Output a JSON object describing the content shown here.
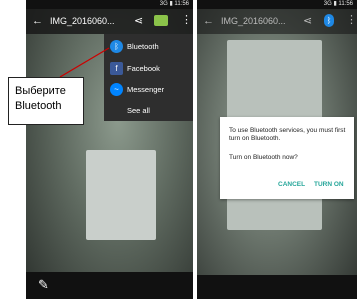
{
  "left_screen": {
    "status": {
      "signal": "3G",
      "time": "11:56"
    },
    "appbar": {
      "back_glyph": "←",
      "title": "IMG_2016060...",
      "share_glyph": "⋖",
      "more_glyph": "⋮"
    },
    "share_menu": [
      {
        "label": "Bluetooth",
        "icon": "bluetooth-icon",
        "glyph": "ᛒ",
        "color": "#1e88e5"
      },
      {
        "label": "Facebook",
        "icon": "facebook-icon",
        "glyph": "f",
        "color": "#3b5998"
      },
      {
        "label": "Messenger",
        "icon": "messenger-icon",
        "glyph": "~",
        "color": "#0084ff"
      },
      {
        "label": "See all",
        "icon": "",
        "glyph": "",
        "color": ""
      }
    ],
    "callout": {
      "line1": "Выберите",
      "line2": "Bluetooth"
    },
    "edit_glyph": "✎"
  },
  "right_screen": {
    "status": {
      "signal": "3G",
      "time": "11:56"
    },
    "appbar": {
      "back_glyph": "←",
      "title": "IMG_2016060...",
      "share_glyph": "⋖",
      "bt_glyph": "ᛒ",
      "more_glyph": "⋮"
    },
    "dialog": {
      "message": "To use Bluetooth services, you must first turn on Bluetooth.",
      "question": "Turn on Bluetooth now?",
      "cancel_label": "CANCEL",
      "confirm_label": "TURN ON"
    }
  },
  "colors": {
    "accent": "#26a69a",
    "bluetooth": "#1e88e5",
    "message_green": "#8bc34a",
    "arrow": "#cc0000"
  }
}
